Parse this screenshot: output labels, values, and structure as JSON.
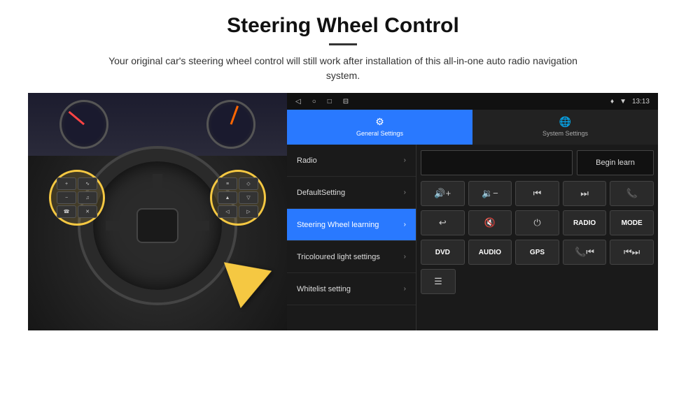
{
  "header": {
    "title": "Steering Wheel Control",
    "divider": true,
    "subtitle": "Your original car's steering wheel control will still work after installation of this all-in-one auto radio navigation system."
  },
  "status_bar": {
    "nav_icons": [
      "◁",
      "○",
      "□",
      "⊟"
    ],
    "right_icons": [
      "♦",
      "▼",
      "13:13"
    ]
  },
  "tabs": [
    {
      "id": "general",
      "icon": "⚙",
      "label": "General Settings",
      "active": true
    },
    {
      "id": "system",
      "icon": "🌐",
      "label": "System Settings",
      "active": false
    }
  ],
  "menu_items": [
    {
      "id": "radio",
      "label": "Radio",
      "active": false
    },
    {
      "id": "default",
      "label": "DefaultSetting",
      "active": false
    },
    {
      "id": "steering",
      "label": "Steering Wheel learning",
      "active": true
    },
    {
      "id": "tricoloured",
      "label": "Tricoloured light settings",
      "active": false
    },
    {
      "id": "whitelist",
      "label": "Whitelist setting",
      "active": false
    }
  ],
  "right_panel": {
    "begin_learn": "Begin learn",
    "button_rows": [
      [
        "vol+",
        "vol-",
        "|◀◀",
        "▶▶|",
        "☎"
      ],
      [
        "↩",
        "🔇",
        "⏻",
        "RADIO",
        "MODE"
      ],
      [
        "DVD",
        "AUDIO",
        "GPS",
        "☎◀◀",
        "◀◀▶▶"
      ],
      [
        "≡"
      ]
    ]
  }
}
